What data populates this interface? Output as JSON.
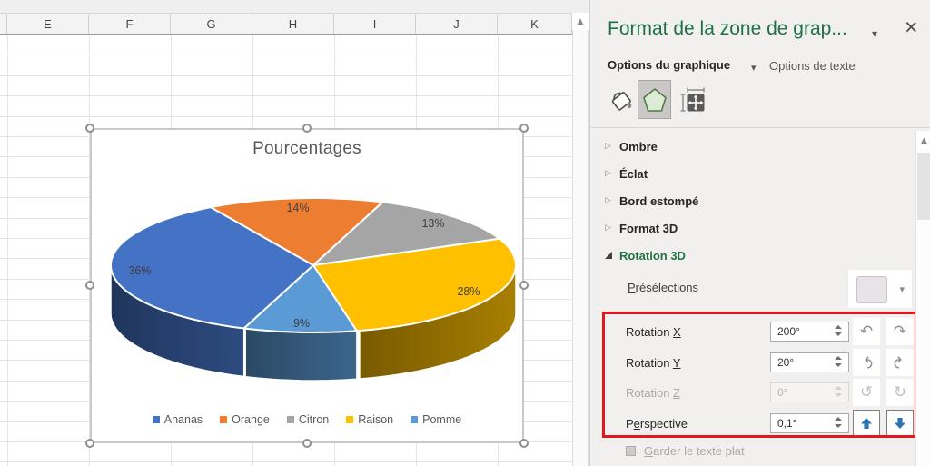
{
  "worksheet": {
    "column_headers": [
      "E",
      "F",
      "G",
      "H",
      "I",
      "J",
      "K"
    ]
  },
  "chart_data": {
    "type": "pie",
    "style": "3d",
    "title": "Pourcentages",
    "categories": [
      "Ananas",
      "Orange",
      "Citron",
      "Raison",
      "Pomme"
    ],
    "values": [
      36,
      14,
      13,
      28,
      9
    ],
    "data_labels": [
      "36%",
      "14%",
      "13%",
      "28%",
      "9%"
    ],
    "colors": [
      "#4472C4",
      "#ED7D31",
      "#A5A5A5",
      "#FFC000",
      "#5B9BD5"
    ],
    "start_angle_deg": 200,
    "legend_position": "bottom",
    "label_color": "#3f3f3f"
  },
  "panel": {
    "title": "Format de la zone de grap...",
    "close_label": "×",
    "caret_down": "▾",
    "scroll_up_arrow": "▲",
    "collapsed_marker": "▷",
    "tabs": [
      {
        "label": "Options du graphique",
        "active": true
      },
      {
        "label": "Options de texte",
        "active": false
      }
    ],
    "toolbar_icons": [
      "fill-icon",
      "effects-icon",
      "size-properties-icon"
    ],
    "sections": [
      {
        "label": "Ombre",
        "expanded": false
      },
      {
        "label": "Éclat",
        "expanded": false
      },
      {
        "label": "Bord estompé",
        "expanded": false
      },
      {
        "label": "Format 3D",
        "expanded": false
      },
      {
        "label": "Rotation 3D",
        "expanded": true
      }
    ],
    "rotation": {
      "presets_label": {
        "pre": "",
        "accel": "P",
        "post": "résélections"
      },
      "rows": [
        {
          "key": "rotation-x",
          "label": {
            "pre": "Rotation ",
            "accel": "X",
            "post": ""
          },
          "value": "200°",
          "disabled": false,
          "icons": [
            "yaw-left-icon",
            "yaw-right-icon"
          ]
        },
        {
          "key": "rotation-y",
          "label": {
            "pre": "Rotation ",
            "accel": "Y",
            "post": ""
          },
          "value": "20°",
          "disabled": false,
          "icons": [
            "pitch-up-icon",
            "pitch-down-icon"
          ]
        },
        {
          "key": "rotation-z",
          "label": {
            "pre": "Rotation ",
            "accel": "Z",
            "post": ""
          },
          "value": "0°",
          "disabled": true,
          "icons": [
            "roll-left-icon",
            "roll-right-icon"
          ]
        },
        {
          "key": "perspective",
          "label": {
            "pre": "P",
            "accel": "e",
            "post": "rspective"
          },
          "value": "0,1°",
          "disabled": false,
          "icons": [
            "perspective-up-icon",
            "perspective-down-icon"
          ]
        }
      ],
      "keep_text_flat": {
        "pre": "",
        "accel": "G",
        "post": "arder le texte plat"
      }
    },
    "accent_green": "#217346",
    "annotation_red": "#E1181E",
    "perspective_arrow_blue": "#2E74B5"
  }
}
